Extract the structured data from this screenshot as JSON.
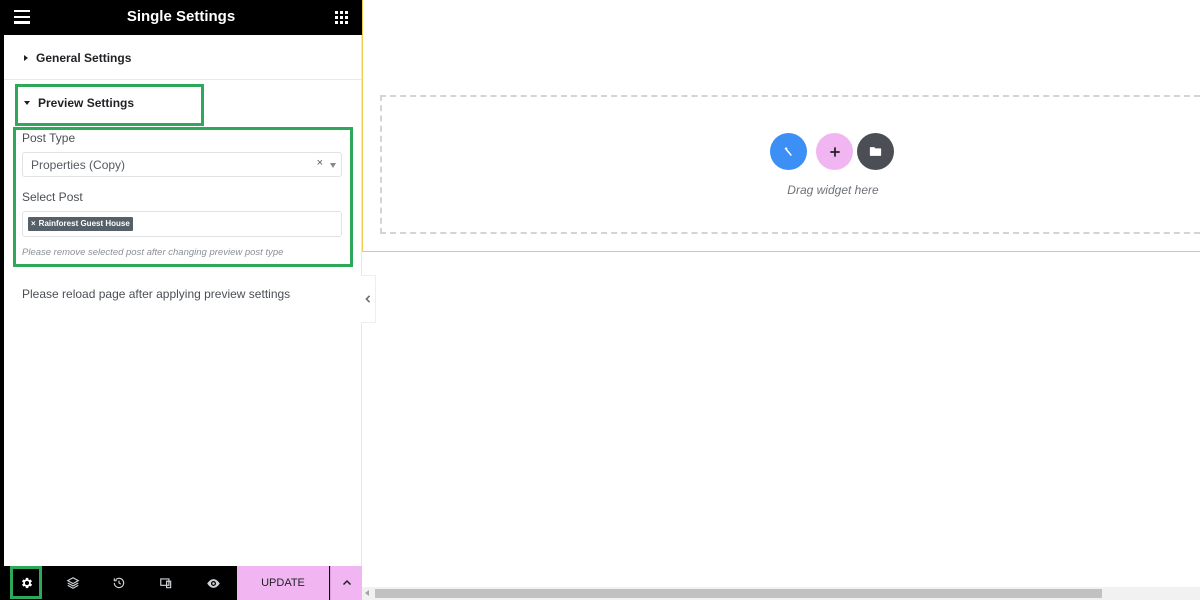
{
  "header": {
    "title": "Single Settings",
    "menu_icon": "hamburger-icon",
    "apps_icon": "grid-icon"
  },
  "sections": {
    "general": {
      "label": "General Settings",
      "expanded": false
    },
    "preview": {
      "label": "Preview Settings",
      "expanded": true
    }
  },
  "preview_settings": {
    "post_type_label": "Post Type",
    "post_type_value": "Properties (Copy)",
    "clear_symbol": "×",
    "select_post_label": "Select Post",
    "selected_tag": "Rainforest Guest House",
    "tag_remove_symbol": "×",
    "hint": "Please remove selected post after changing preview post type"
  },
  "reload_note": "Please reload page after applying preview settings",
  "bottombar": {
    "icons": [
      "gear-icon",
      "layers-icon",
      "history-icon",
      "responsive-icon",
      "eye-icon"
    ],
    "update_label": "UPDATE"
  },
  "canvas": {
    "drag_text": "Drag widget here",
    "buttons": [
      "wand-icon",
      "plus-icon",
      "folder-icon"
    ]
  },
  "colors": {
    "accent_pink": "#f1b6f2",
    "blue": "#3b8ff5",
    "highlight_green": "#2ea85a",
    "section_border": "#f2c94c"
  }
}
